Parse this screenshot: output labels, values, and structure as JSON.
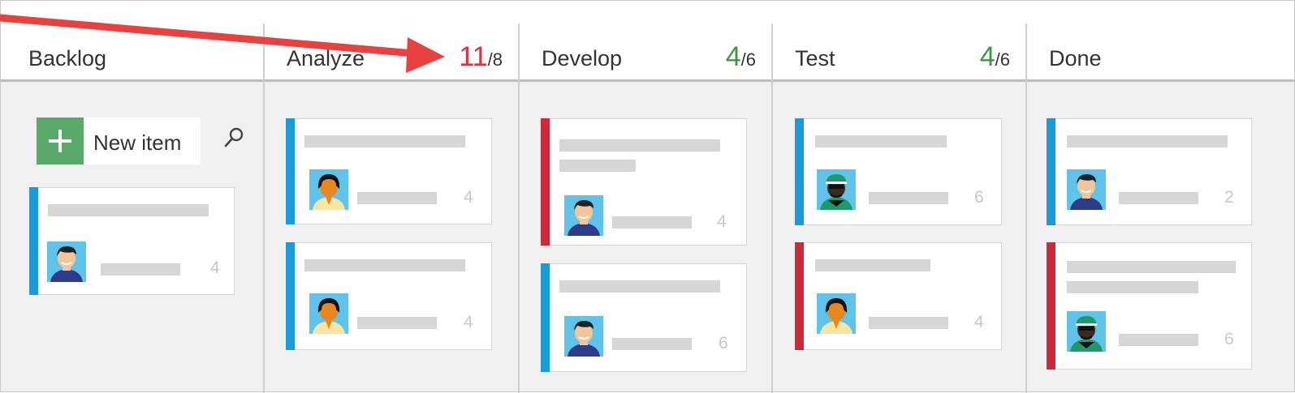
{
  "columns": [
    {
      "name": "Backlog",
      "count": null
    },
    {
      "name": "Analyze",
      "count": {
        "current": "11",
        "limit": "/8",
        "color": "#e0303a"
      }
    },
    {
      "name": "Develop",
      "count": {
        "current": "4",
        "limit": "/6",
        "color": "#3a9a3a"
      }
    },
    {
      "name": "Test",
      "count": {
        "current": "4",
        "limit": "/6",
        "color": "#3a9a3a"
      }
    },
    {
      "name": "Done",
      "count": null
    }
  ],
  "backlog": {
    "new_item_label": "New item",
    "icons": {
      "add": "plus-icon",
      "search": "search-icon"
    }
  },
  "cards": {
    "backlog": [
      {
        "estimate": "4",
        "type": "blue",
        "avatar": "man-dark-hair"
      }
    ],
    "analyze": [
      {
        "estimate": "4",
        "type": "blue",
        "avatar": "woman-orange"
      },
      {
        "estimate": "4",
        "type": "blue",
        "avatar": "woman-orange"
      }
    ],
    "develop": [
      {
        "estimate": "4",
        "type": "red",
        "avatar": "man-dark-hair"
      },
      {
        "estimate": "6",
        "type": "blue",
        "avatar": "man-dark-hair"
      }
    ],
    "test": [
      {
        "estimate": "6",
        "type": "blue",
        "avatar": "man-green-cap"
      },
      {
        "estimate": "4",
        "type": "red",
        "avatar": "woman-orange"
      }
    ],
    "done": [
      {
        "estimate": "2",
        "type": "blue",
        "avatar": "man-dark-hair"
      },
      {
        "estimate": "6",
        "type": "red",
        "avatar": "man-green-cap"
      }
    ]
  },
  "colors": {
    "blue_bar": "#1a9bd7",
    "red_bar": "#cc293d",
    "over_limit": "#e0303a",
    "within_limit": "#3a9a3a",
    "arrow": "#e8413f"
  }
}
